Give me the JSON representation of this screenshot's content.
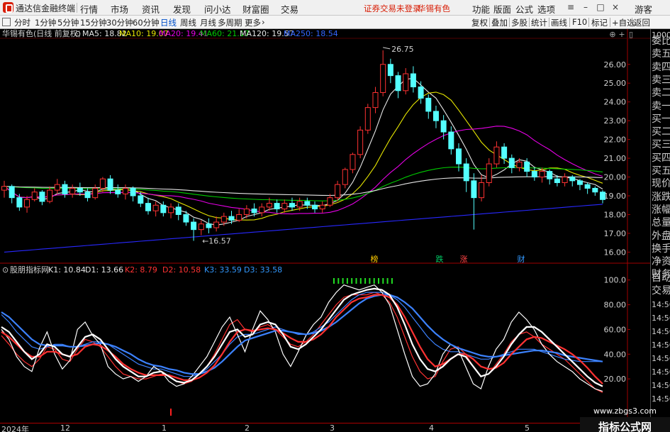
{
  "app": {
    "title": "通达信金融终端",
    "menu": [
      "行情",
      "市场",
      "资讯",
      "发现",
      "问小达",
      "财富圈",
      "交易"
    ],
    "warning": "证券交易未登录",
    "stock_name_top": "华锡有色",
    "right_menu": [
      "功能",
      "版面",
      "公式",
      "选项"
    ],
    "guest": "游客"
  },
  "toolbar": {
    "periods": [
      "分时",
      "1分钟",
      "5分钟",
      "15分钟",
      "30分钟",
      "60分钟",
      "日线",
      "周线",
      "月线",
      "多周期",
      "更多"
    ],
    "active_period": "日线",
    "right_buttons": [
      "复权",
      "叠加",
      "多股",
      "统计",
      "画线",
      "F10",
      "标记",
      "+自选",
      "返回"
    ]
  },
  "main_chart": {
    "title": "华锡有色(日线 前复权)",
    "ma_labels": [
      {
        "text": "MA5: 18.82",
        "color": "#e6e6e6"
      },
      {
        "text": "MA10: 19.07",
        "color": "#e6e600"
      },
      {
        "text": "MA20: 19.41",
        "color": "#e600e6"
      },
      {
        "text": "MA60: 21.17",
        "color": "#00cc00"
      },
      {
        "text": "MA120: 19.57",
        "color": "#e6e6e6"
      },
      {
        "text": "MA250: 18.54",
        "color": "#3366ff"
      }
    ],
    "y_ticks": [
      "26.00",
      "25.00",
      "24.00",
      "23.00",
      "22.00",
      "21.00",
      "20.00",
      "19.00",
      "18.00",
      "17.00",
      "16.00"
    ],
    "high_label": "26.75",
    "low_label": "16.57",
    "event_markers": [
      {
        "text": "榜",
        "color": "#ffcc00"
      },
      {
        "text": "跌",
        "color": "#00cc66"
      },
      {
        "text": "涨",
        "color": "#ff4444"
      },
      {
        "text": "财",
        "color": "#3399ff"
      }
    ]
  },
  "indicator": {
    "name": "股朋指标网",
    "labels": [
      {
        "text": "K1: 10.84",
        "color": "#e6e6e6"
      },
      {
        "text": "D1: 13.66",
        "color": "#e6e6e6"
      },
      {
        "text": "K2: 8.79",
        "color": "#ff3333"
      },
      {
        "text": "D2: 10.58",
        "color": "#ff3333"
      },
      {
        "text": "K3: 33.59",
        "color": "#3399ff"
      },
      {
        "text": "D3: 33.58",
        "color": "#3399ff"
      }
    ],
    "y_ticks": [
      "100.0",
      "80.00",
      "60.00",
      "40.00",
      "20.00"
    ]
  },
  "right_panel": {
    "top_small": "1000",
    "items": [
      "委比",
      "卖五",
      "卖四",
      "卖三",
      "卖二",
      "卖一",
      "买一",
      "买二",
      "买三",
      "买四",
      "买五",
      "现价",
      "涨跌",
      "涨幅",
      "总量",
      "外盘",
      "换手",
      "净资",
      "财务"
    ],
    "lower_items": [
      "自动",
      "交易"
    ],
    "times": [
      "14:56",
      "14:56",
      "14:56",
      "14:56",
      "14:56",
      "14:56",
      "14:56",
      "14:56"
    ]
  },
  "date_axis": {
    "labels": [
      "2024年",
      "12",
      "1",
      "2",
      "3",
      "4",
      "5"
    ]
  },
  "watermark": {
    "main": "指标公式网",
    "sub": "www.zbgs3.com"
  },
  "colors": {
    "up": "#ff3232",
    "down": "#54ffff",
    "ma5": "#e6e6e6",
    "ma10": "#e6e600",
    "ma20": "#e600e6",
    "ma60": "#00cc00",
    "ma120": "#e6e6e6",
    "ma250": "#2828ff"
  },
  "chart_data": [
    {
      "type": "candlestick",
      "title": "华锡有色(日线 前复权)",
      "ylim": [
        15.6,
        27.2
      ],
      "candles": [
        [
          19.3,
          19.5,
          19.8,
          18.9
        ],
        [
          19.5,
          18.9,
          19.6,
          18.6
        ],
        [
          18.9,
          18.4,
          19.1,
          18.2
        ],
        [
          18.4,
          18.8,
          19.0,
          18.1
        ],
        [
          18.8,
          19.2,
          19.4,
          18.7
        ],
        [
          19.2,
          18.7,
          19.3,
          18.5
        ],
        [
          18.7,
          19.3,
          19.5,
          18.6
        ],
        [
          19.3,
          19.6,
          19.9,
          19.1
        ],
        [
          19.6,
          19.1,
          19.8,
          18.9
        ],
        [
          19.1,
          19.4,
          19.6,
          18.9
        ],
        [
          19.4,
          19.2,
          19.7,
          19.0
        ],
        [
          19.2,
          18.9,
          19.4,
          18.7
        ],
        [
          18.9,
          19.4,
          19.6,
          18.8
        ],
        [
          19.4,
          19.9,
          20.0,
          19.2
        ],
        [
          19.9,
          19.3,
          20.1,
          19.1
        ],
        [
          19.3,
          19.1,
          19.6,
          18.9
        ],
        [
          19.1,
          19.4,
          19.6,
          18.8
        ],
        [
          19.4,
          19.0,
          19.5,
          18.7
        ],
        [
          19.0,
          18.6,
          19.2,
          18.4
        ],
        [
          18.6,
          18.2,
          18.9,
          18.0
        ],
        [
          18.2,
          18.5,
          18.7,
          17.9
        ],
        [
          18.5,
          18.1,
          18.7,
          17.9
        ],
        [
          18.1,
          18.4,
          18.6,
          17.8
        ],
        [
          18.4,
          18.0,
          18.6,
          17.7
        ],
        [
          18.0,
          17.6,
          18.2,
          17.4
        ],
        [
          17.6,
          17.2,
          17.8,
          16.6
        ],
        [
          17.2,
          17.5,
          17.7,
          16.9
        ],
        [
          17.5,
          17.3,
          17.8,
          17.0
        ],
        [
          17.3,
          17.6,
          17.9,
          17.1
        ],
        [
          17.6,
          17.9,
          18.1,
          17.4
        ],
        [
          17.9,
          17.7,
          18.2,
          17.5
        ],
        [
          17.7,
          18.0,
          18.3,
          17.6
        ],
        [
          18.0,
          18.3,
          18.5,
          17.8
        ],
        [
          18.3,
          18.1,
          18.6,
          17.9
        ],
        [
          18.1,
          18.4,
          18.6,
          17.9
        ],
        [
          18.4,
          18.6,
          18.9,
          18.2
        ],
        [
          18.6,
          18.3,
          18.8,
          18.1
        ],
        [
          18.3,
          18.6,
          18.8,
          18.1
        ],
        [
          18.6,
          18.4,
          18.9,
          18.2
        ],
        [
          18.4,
          18.7,
          18.9,
          18.2
        ],
        [
          18.7,
          18.5,
          18.9,
          18.3
        ],
        [
          18.5,
          18.3,
          18.7,
          18.1
        ],
        [
          18.3,
          18.5,
          18.7,
          18.1
        ],
        [
          18.5,
          18.9,
          19.1,
          18.4
        ],
        [
          18.9,
          19.6,
          19.8,
          18.7
        ],
        [
          19.6,
          20.4,
          20.5,
          19.4
        ],
        [
          20.4,
          21.2,
          21.3,
          20.2
        ],
        [
          21.2,
          22.5,
          22.7,
          21.0
        ],
        [
          22.5,
          23.7,
          23.9,
          22.3
        ],
        [
          23.7,
          24.5,
          24.8,
          23.4
        ],
        [
          24.5,
          26.0,
          26.75,
          24.3
        ],
        [
          26.0,
          25.4,
          26.3,
          25.0
        ],
        [
          25.4,
          24.6,
          25.6,
          24.2
        ],
        [
          24.6,
          25.5,
          25.8,
          24.4
        ],
        [
          25.5,
          24.8,
          25.9,
          24.5
        ],
        [
          24.8,
          24.2,
          25.1,
          23.9
        ],
        [
          24.2,
          23.5,
          24.4,
          23.1
        ],
        [
          23.5,
          23.0,
          23.8,
          22.6
        ],
        [
          23.0,
          22.4,
          23.3,
          22.0
        ],
        [
          22.4,
          21.5,
          22.7,
          21.2
        ],
        [
          21.5,
          20.7,
          21.8,
          20.3
        ],
        [
          20.7,
          19.8,
          21.0,
          19.2
        ],
        [
          19.8,
          18.9,
          20.2,
          17.2
        ],
        [
          18.9,
          19.7,
          20.1,
          18.7
        ],
        [
          19.7,
          20.7,
          21.0,
          19.5
        ],
        [
          20.7,
          21.6,
          21.9,
          20.5
        ],
        [
          21.6,
          21.0,
          21.8,
          20.7
        ],
        [
          21.0,
          20.5,
          21.2,
          20.2
        ],
        [
          20.5,
          20.8,
          21.0,
          20.3
        ],
        [
          20.8,
          20.3,
          21.0,
          20.0
        ],
        [
          20.3,
          20.0,
          20.5,
          19.8
        ],
        [
          20.0,
          20.3,
          20.5,
          19.7
        ],
        [
          20.3,
          19.9,
          20.4,
          19.6
        ],
        [
          19.9,
          19.7,
          20.1,
          19.5
        ],
        [
          19.7,
          20.0,
          20.2,
          19.5
        ],
        [
          20.0,
          19.8,
          20.1,
          19.5
        ],
        [
          19.8,
          19.6,
          19.9,
          19.3
        ],
        [
          19.6,
          19.4,
          19.7,
          19.1
        ],
        [
          19.4,
          19.2,
          19.5,
          19.0
        ],
        [
          19.2,
          18.8,
          19.3,
          18.6
        ]
      ]
    },
    {
      "type": "line",
      "title": "股朋指标网",
      "ylim": [
        0,
        105
      ],
      "series": [
        {
          "name": "K1",
          "color": "#ffffff",
          "values": [
            60,
            52,
            38,
            30,
            26,
            45,
            58,
            40,
            28,
            35,
            60,
            66,
            55,
            48,
            30,
            24,
            20,
            22,
            18,
            22,
            30,
            26,
            18,
            14,
            16,
            22,
            30,
            38,
            50,
            62,
            70,
            56,
            42,
            60,
            75,
            68,
            58,
            40,
            30,
            42,
            55,
            64,
            70,
            82,
            90,
            96,
            94,
            92,
            94,
            96,
            90,
            80,
            60,
            40,
            22,
            14,
            16,
            24,
            40,
            48,
            44,
            30,
            16,
            12,
            30,
            44,
            52,
            66,
            74,
            68,
            60,
            48,
            40,
            34,
            30,
            26,
            20,
            16,
            12,
            10
          ]
        },
        {
          "name": "D1",
          "color": "#ffffff",
          "values": [
            62,
            58,
            50,
            42,
            36,
            40,
            48,
            46,
            40,
            38,
            46,
            54,
            56,
            52,
            44,
            36,
            30,
            26,
            22,
            22,
            25,
            26,
            22,
            18,
            17,
            19,
            24,
            30,
            38,
            48,
            58,
            60,
            54,
            56,
            64,
            66,
            64,
            56,
            46,
            44,
            48,
            54,
            60,
            68,
            76,
            84,
            88,
            90,
            92,
            93,
            92,
            88,
            78,
            64,
            48,
            36,
            28,
            26,
            30,
            36,
            40,
            38,
            30,
            22,
            24,
            30,
            38,
            48,
            56,
            62,
            62,
            58,
            52,
            46,
            40,
            34,
            28,
            22,
            17,
            14
          ]
        },
        {
          "name": "K2",
          "color": "#ff3232",
          "values": [
            55,
            48,
            40,
            34,
            30,
            36,
            46,
            44,
            36,
            34,
            44,
            52,
            50,
            46,
            38,
            30,
            24,
            22,
            20,
            20,
            22,
            24,
            22,
            18,
            16,
            18,
            24,
            30,
            40,
            52,
            64,
            68,
            60,
            58,
            62,
            64,
            60,
            54,
            48,
            46,
            50,
            56,
            64,
            72,
            80,
            86,
            88,
            88,
            88,
            90,
            88,
            82,
            70,
            54,
            38,
            26,
            20,
            22,
            34,
            44,
            46,
            40,
            30,
            22,
            24,
            32,
            40,
            50,
            56,
            58,
            54,
            48,
            44,
            40,
            36,
            30,
            24,
            18,
            12,
            9
          ]
        },
        {
          "name": "D2",
          "color": "#ff3232",
          "values": [
            58,
            54,
            48,
            42,
            38,
            38,
            42,
            42,
            40,
            38,
            40,
            46,
            48,
            47,
            43,
            38,
            32,
            28,
            25,
            23,
            23,
            23,
            23,
            21,
            19,
            19,
            21,
            25,
            31,
            40,
            50,
            58,
            60,
            59,
            60,
            61,
            60,
            57,
            53,
            50,
            50,
            52,
            56,
            62,
            70,
            76,
            82,
            85,
            86,
            88,
            88,
            86,
            80,
            70,
            58,
            46,
            36,
            30,
            32,
            36,
            40,
            40,
            36,
            30,
            28,
            29,
            33,
            40,
            46,
            52,
            54,
            53,
            50,
            47,
            44,
            40,
            35,
            29,
            22,
            16
          ]
        },
        {
          "name": "K3",
          "color": "#3c82ff",
          "values": [
            72,
            66,
            58,
            52,
            46,
            44,
            46,
            48,
            48,
            46,
            46,
            48,
            50,
            50,
            48,
            44,
            40,
            36,
            32,
            30,
            28,
            28,
            26,
            24,
            22,
            22,
            24,
            28,
            34,
            40,
            48,
            54,
            56,
            56,
            58,
            60,
            62,
            60,
            58,
            56,
            56,
            58,
            62,
            66,
            72,
            78,
            84,
            88,
            90,
            90,
            90,
            88,
            84,
            78,
            70,
            62,
            54,
            48,
            44,
            42,
            42,
            40,
            38,
            36,
            36,
            38,
            40,
            42,
            44,
            44,
            44,
            42,
            40,
            38,
            36,
            35,
            34,
            34,
            34,
            34
          ]
        },
        {
          "name": "D3",
          "color": "#3c82ff",
          "values": [
            74,
            70,
            64,
            58,
            52,
            48,
            47,
            47,
            47,
            46,
            46,
            47,
            48,
            49,
            48,
            46,
            43,
            40,
            36,
            33,
            31,
            30,
            28,
            27,
            25,
            24,
            24,
            26,
            29,
            34,
            40,
            46,
            51,
            53,
            55,
            57,
            59,
            59,
            58,
            57,
            56,
            57,
            59,
            62,
            66,
            71,
            76,
            81,
            85,
            87,
            88,
            88,
            86,
            82,
            77,
            70,
            63,
            57,
            52,
            48,
            45,
            43,
            41,
            39,
            38,
            38,
            39,
            40,
            41,
            42,
            43,
            43,
            42,
            41,
            39,
            38,
            37,
            36,
            35,
            34
          ]
        }
      ]
    }
  ]
}
